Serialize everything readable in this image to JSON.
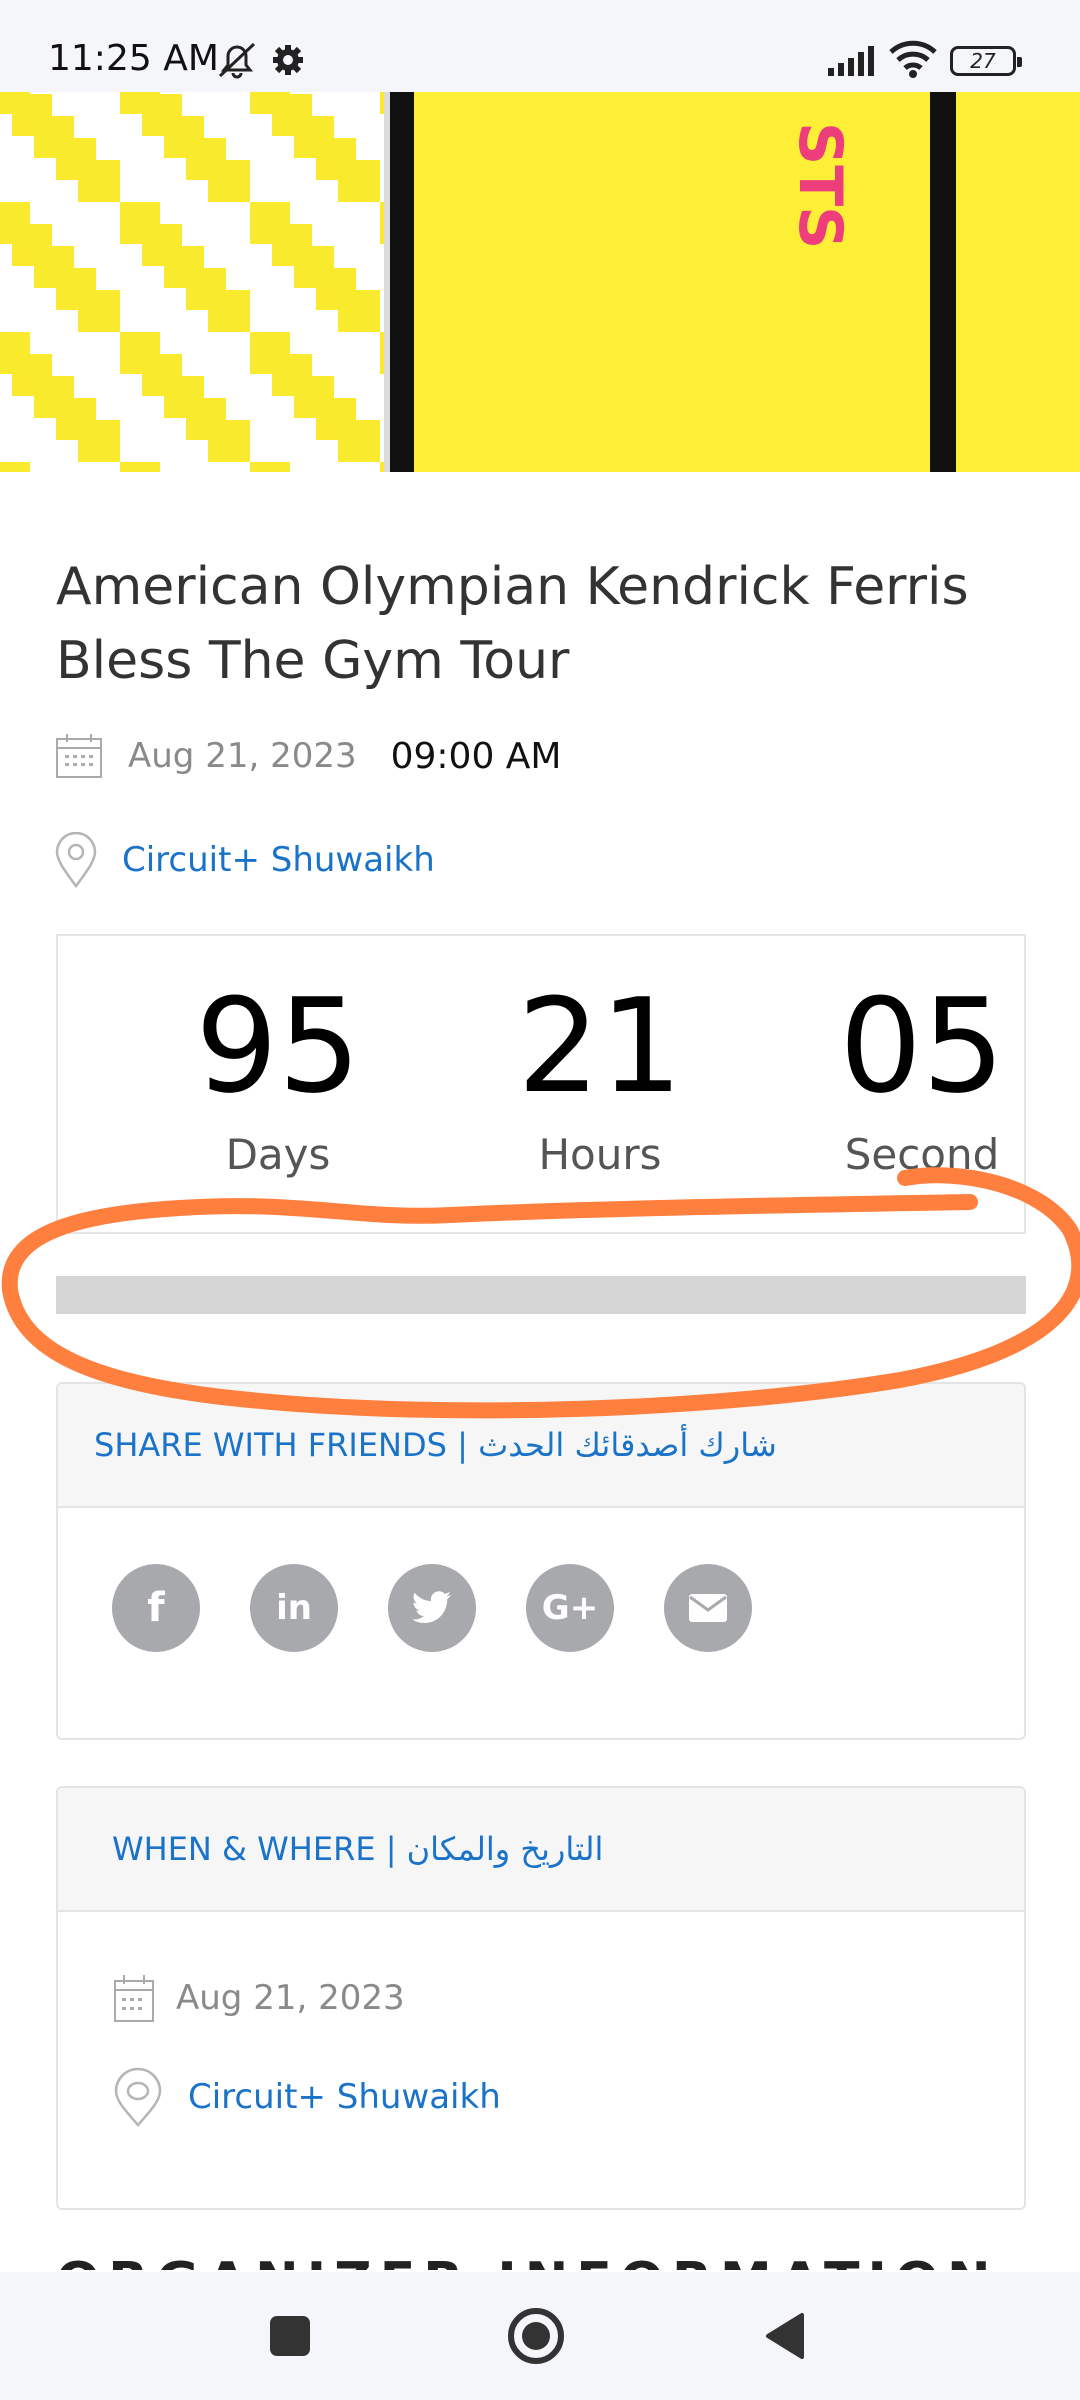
{
  "status_bar": {
    "time": "11:25 AM",
    "battery": "27",
    "icons": [
      "mute-icon",
      "gear-icon",
      "signal-icon",
      "wifi-icon",
      "battery-icon"
    ]
  },
  "event": {
    "title": "American Olympian Kendrick Ferris Bless The Gym Tour",
    "date": "Aug 21, 2023",
    "time": "09:00 AM",
    "location": "Circuit+ Shuwaikh"
  },
  "countdown": {
    "days_value": "95",
    "days_label": "Days",
    "hours_value": "21",
    "hours_label": "Hours",
    "seconds_value": "05",
    "seconds_label": "Second"
  },
  "share": {
    "header": "SHARE WITH FRIENDS | شارك أصدقائك الحدث",
    "buttons": [
      {
        "icon": "facebook-icon",
        "glyph": "f"
      },
      {
        "icon": "linkedin-icon",
        "glyph": "in"
      },
      {
        "icon": "twitter-icon",
        "glyph": "🐦"
      },
      {
        "icon": "google-plus-icon",
        "glyph": "G+"
      },
      {
        "icon": "email-icon",
        "glyph": "✉"
      }
    ]
  },
  "when_where": {
    "header": "WHEN & WHERE | التاريخ والمكان",
    "date": "Aug 21, 2023",
    "location": "Circuit+ Shuwaikh"
  },
  "next_section_peek": "ORGANIZER INFORMATION |",
  "colors": {
    "link": "#1a73c8",
    "banner": "#fdef35",
    "annotation": "#ff7f3f",
    "social": "#a7a9ac"
  },
  "nav": [
    "recents-button",
    "home-button",
    "back-button"
  ]
}
